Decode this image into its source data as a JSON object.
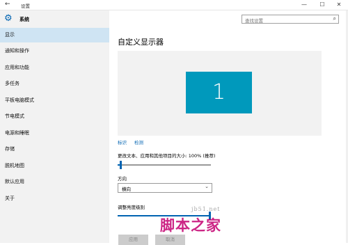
{
  "window": {
    "back_glyph": "←",
    "title": "设置",
    "minimize_glyph": "—",
    "maximize_glyph": "☐",
    "close_glyph": "✕"
  },
  "sidebar": {
    "title": "系统",
    "items": [
      {
        "label": "显示",
        "active": true
      },
      {
        "label": "通知和操作"
      },
      {
        "label": "应用和功能"
      },
      {
        "label": "多任务"
      },
      {
        "label": "平板电脑模式"
      },
      {
        "label": "节电模式"
      },
      {
        "label": "电源和睡眠"
      },
      {
        "label": "存储"
      },
      {
        "label": "脱机地图"
      },
      {
        "label": "默认应用"
      },
      {
        "label": "关于"
      }
    ]
  },
  "search": {
    "placeholder": "查找设置"
  },
  "main": {
    "title": "自定义显示器",
    "monitor_label": "1",
    "identify_link": "标识",
    "detect_link": "检测",
    "scale_label": "更改文本、应用和其他项目的大小: 100% (推荐)",
    "scale_level": 0.02,
    "orientation_label": "方向",
    "orientation_value": "横向",
    "brightness_label": "调整亮度级别",
    "brightness_level": 1.0,
    "apply_label": "应用",
    "cancel_label": "取消"
  },
  "watermark": {
    "text": "脚本之家",
    "sub": "jb51.net"
  },
  "colors": {
    "accent": "#0063b1",
    "monitor": "#0099bc",
    "sidebar_active": "#cfe4f3"
  }
}
